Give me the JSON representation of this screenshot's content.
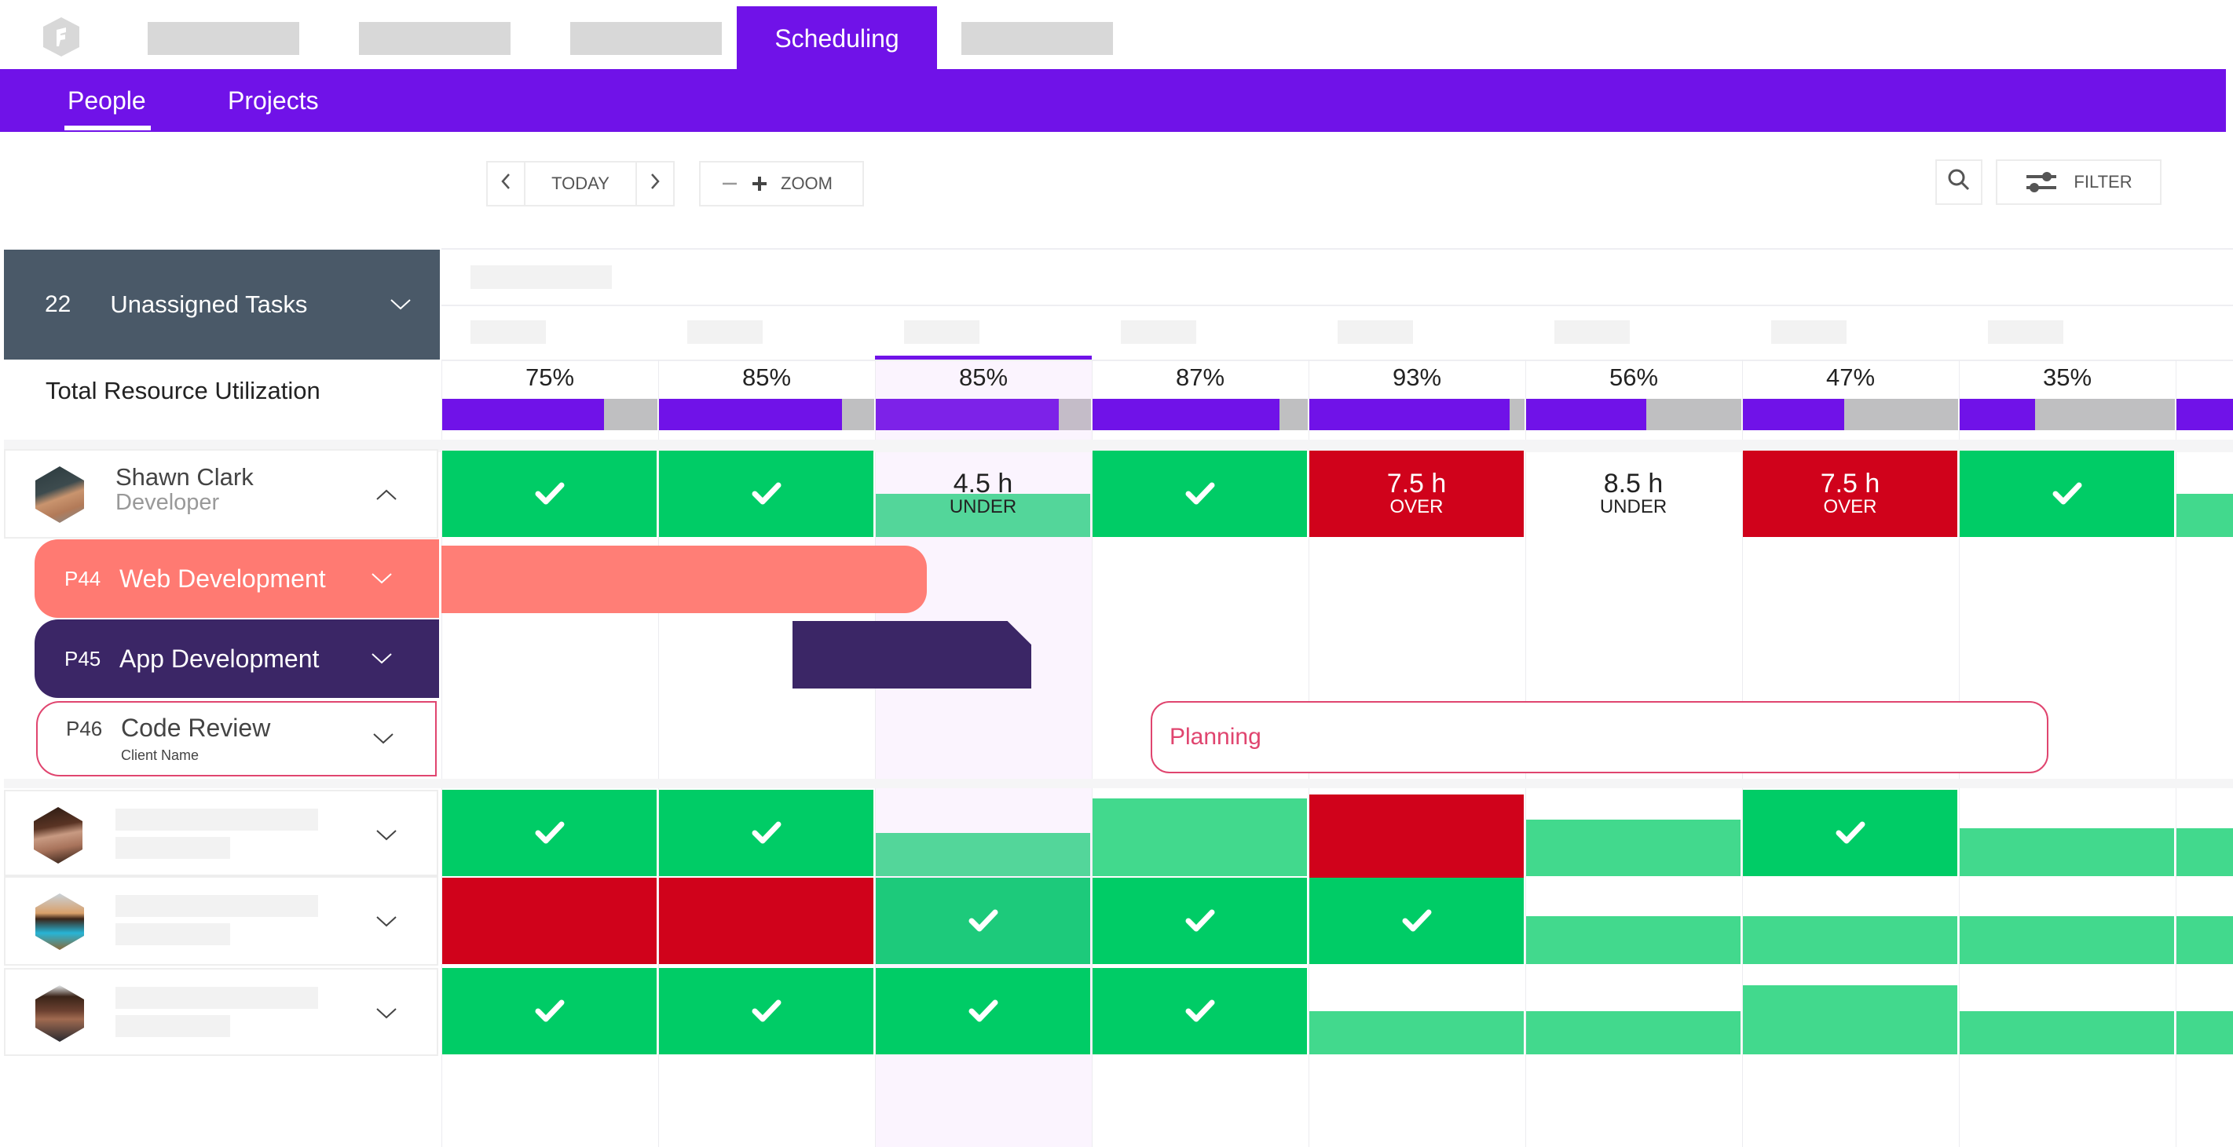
{
  "app": {
    "logo_icon": "hexagon-f-logo",
    "nav_tabs": [
      {
        "label": "",
        "placeholder": true
      },
      {
        "label": "",
        "placeholder": true
      },
      {
        "label": "",
        "placeholder": true
      },
      {
        "label": "Scheduling",
        "active": true
      },
      {
        "label": "",
        "placeholder": true
      }
    ],
    "sub_tabs": [
      {
        "label": "People",
        "active": true
      },
      {
        "label": "Projects",
        "active": false
      }
    ]
  },
  "toolbar": {
    "prev_icon": "chevron-left-icon",
    "today_label": "TODAY",
    "next_icon": "chevron-right-icon",
    "zoom_out_icon": "minus-icon",
    "zoom_in_icon": "plus-icon",
    "zoom_label": "ZOOM",
    "search_icon": "search-icon",
    "filter_icon": "sliders-icon",
    "filter_label": "FILTER"
  },
  "unassigned": {
    "count": "22",
    "label": "Unassigned Tasks"
  },
  "utilization": {
    "label": "Total Resource Utilization",
    "columns": [
      {
        "label": "75%",
        "value": 0.75
      },
      {
        "label": "85%",
        "value": 0.85
      },
      {
        "label": "85%",
        "value": 0.85,
        "today": true
      },
      {
        "label": "87%",
        "value": 0.87
      },
      {
        "label": "93%",
        "value": 0.93
      },
      {
        "label": "56%",
        "value": 0.56
      },
      {
        "label": "47%",
        "value": 0.47
      },
      {
        "label": "35%",
        "value": 0.35
      },
      {
        "label": "",
        "value": 1.0
      }
    ]
  },
  "people": [
    {
      "name": "Shawn Clark",
      "role": "Developer",
      "expanded": true,
      "cells": [
        {
          "type": "ok"
        },
        {
          "type": "ok"
        },
        {
          "type": "under",
          "hours": "4.5 h",
          "state": "UNDER",
          "fill": 0.5
        },
        {
          "type": "ok"
        },
        {
          "type": "over",
          "hours": "7.5 h",
          "state": "OVER"
        },
        {
          "type": "under",
          "hours": "8.5 h",
          "state": "UNDER",
          "fill": 0
        },
        {
          "type": "over",
          "hours": "7.5 h",
          "state": "OVER"
        },
        {
          "type": "ok"
        },
        {
          "type": "partial",
          "fill": 0.5
        }
      ],
      "projects": [
        {
          "code": "P44",
          "name": "Web Development",
          "color": "#ff7a72",
          "bar": {
            "start_col": 0,
            "span_cols": 2.25
          }
        },
        {
          "code": "P45",
          "name": "App Development",
          "color": "#3b2666",
          "bar": {
            "start_col": 1.62,
            "span_cols": 1.1
          }
        },
        {
          "code": "P46",
          "name": "Code Review",
          "client": "Client Name",
          "color": "#e0456f",
          "bar": {
            "start_col": 3.28,
            "span_cols": 4.15,
            "label": "Planning"
          }
        }
      ]
    },
    {
      "name": "",
      "role": "",
      "expanded": false,
      "cells": [
        {
          "type": "ok"
        },
        {
          "type": "ok"
        },
        {
          "type": "partial",
          "fill": 0.5
        },
        {
          "type": "partial",
          "fill": 0.9
        },
        {
          "type": "over-block"
        },
        {
          "type": "partial",
          "fill": 0.65
        },
        {
          "type": "ok"
        },
        {
          "type": "partial",
          "fill": 0.55
        },
        {
          "type": "partial",
          "fill": 0.55
        }
      ]
    },
    {
      "name": "",
      "role": "",
      "expanded": false,
      "cells": [
        {
          "type": "red"
        },
        {
          "type": "red"
        },
        {
          "type": "ok-teal"
        },
        {
          "type": "ok"
        },
        {
          "type": "ok"
        },
        {
          "type": "partial",
          "fill": 0.55
        },
        {
          "type": "partial",
          "fill": 0.55
        },
        {
          "type": "partial",
          "fill": 0.55
        },
        {
          "type": "partial",
          "fill": 0.55
        }
      ]
    },
    {
      "name": "",
      "role": "",
      "expanded": false,
      "cells": [
        {
          "type": "ok"
        },
        {
          "type": "ok"
        },
        {
          "type": "ok"
        },
        {
          "type": "ok"
        },
        {
          "type": "partial",
          "fill": 0.5
        },
        {
          "type": "partial",
          "fill": 0.5
        },
        {
          "type": "partial",
          "fill": 0.8
        },
        {
          "type": "partial",
          "fill": 0.5
        },
        {
          "type": "partial",
          "fill": 0.5
        }
      ]
    }
  ]
}
